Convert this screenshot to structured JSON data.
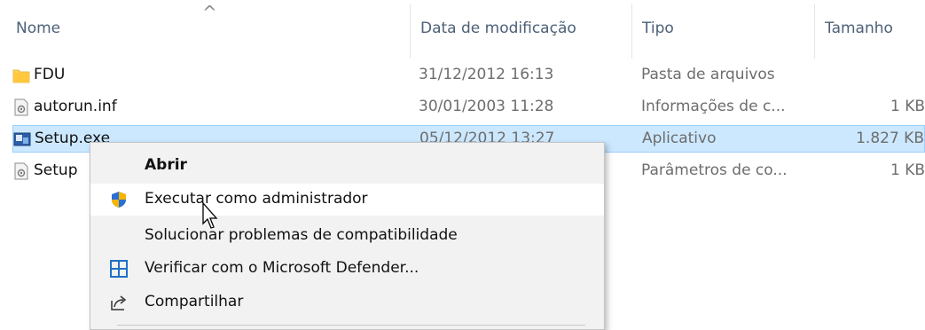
{
  "columns": {
    "name": "Nome",
    "date": "Data de modificação",
    "type": "Tipo",
    "size": "Tamanho"
  },
  "files": [
    {
      "name": "FDU",
      "date": "31/12/2012 16:13",
      "type": "Pasta de arquivos",
      "size": "",
      "icon": "folder-icon"
    },
    {
      "name": "autorun.inf",
      "date": "30/01/2003 11:28",
      "type": "Informações de c...",
      "size": "1 KB",
      "icon": "settings-file-icon"
    },
    {
      "name": "Setup.exe",
      "date": "05/12/2012 13:27",
      "type": "Aplicativo",
      "size": "1.827 KB",
      "icon": "setup-app-icon"
    },
    {
      "name": "Setup",
      "date": "",
      "type": "Parâmetros de co...",
      "size": "1 KB",
      "icon": "settings-file-icon"
    }
  ],
  "context_menu": {
    "items": [
      {
        "label": "Abrir",
        "icon": ""
      },
      {
        "label": "Executar como administrador",
        "icon": "uac-shield-icon"
      },
      {
        "label": "Solucionar problemas de compatibilidade",
        "icon": ""
      },
      {
        "label": "Verificar com o Microsoft Defender...",
        "icon": "defender-icon"
      },
      {
        "label": "Compartilhar",
        "icon": "share-icon"
      }
    ]
  },
  "colors": {
    "selection": "#cce8ff",
    "header_text": "#4c6077",
    "folder": "#ffd35c"
  }
}
